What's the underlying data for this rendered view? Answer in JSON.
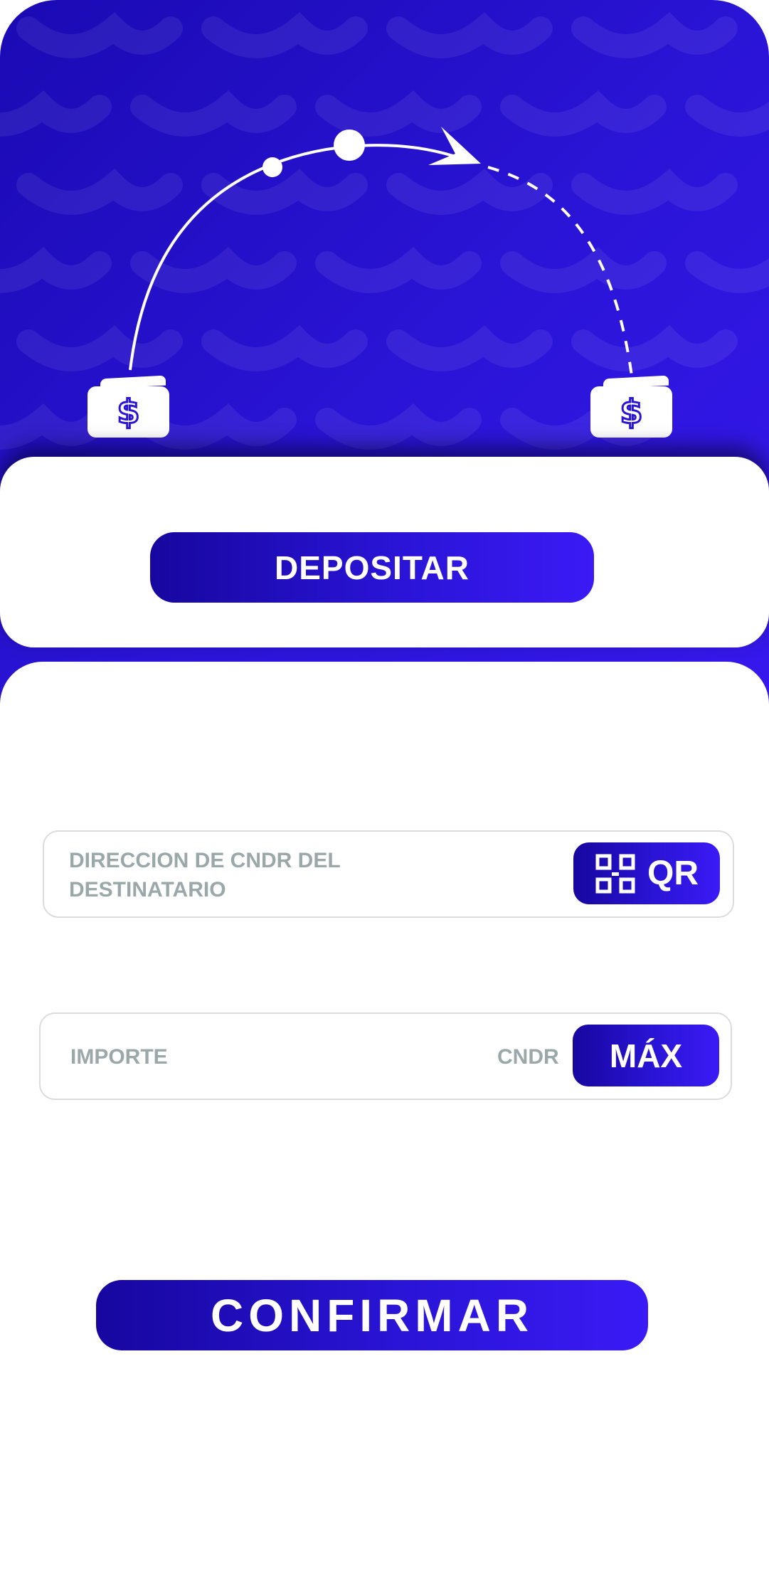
{
  "header": {
    "left_icon": "wallet-dollar-icon",
    "right_icon": "wallet-dollar-icon",
    "wallet_symbol": "$",
    "arrow_icon": "transfer-arrow-icon"
  },
  "tabs": {
    "deposit_label": "DEPOSITAR"
  },
  "form": {
    "address_label": "DIRECCION DE CNDR DEL DESTINATARIO",
    "qr_button_label": "QR",
    "qr_icon": "qr-code-icon",
    "amount_label": "IMPORTE",
    "amount_unit": "CNDR",
    "max_button_label": "MÁX"
  },
  "actions": {
    "confirm_label": "CONFIRMAR"
  },
  "colors": {
    "accent_dark": "#17079f",
    "accent": "#2a14d6",
    "accent_light": "#3b1af5",
    "label_gray": "#9aa8aa",
    "field_border": "#dcdcdc"
  }
}
